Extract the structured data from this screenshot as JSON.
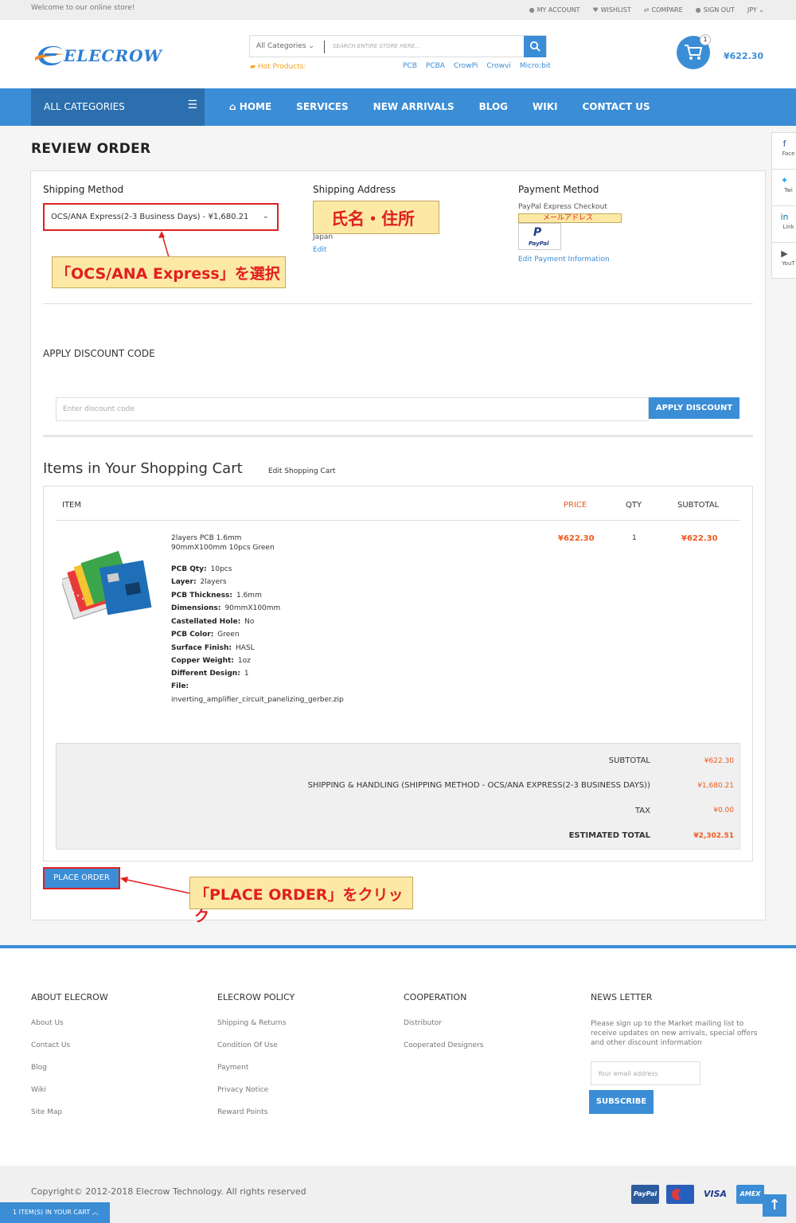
{
  "topbar": {
    "welcome": "Welcome to our online store!",
    "links": [
      "MY ACCOUNT",
      "WISHLIST",
      "COMPARE",
      "SIGN OUT",
      "JPY"
    ]
  },
  "header": {
    "logo": "ELECROW",
    "search_category": "All Categories",
    "search_placeholder": "SEARCH ENTIRE STORE HERE...",
    "hot_label": "Hot Products:",
    "hot_links": [
      "PCB",
      "PCBA",
      "CrowPi",
      "Crowvi",
      "Micro:bit"
    ],
    "cart_count": "1",
    "cart_total": "¥622.30"
  },
  "nav": {
    "all_categories": "ALL CATEGORIES",
    "items": [
      "HOME",
      "SERVICES",
      "NEW ARRIVALS",
      "BLOG",
      "WIKI",
      "CONTACT US"
    ]
  },
  "review": {
    "title": "REVIEW ORDER",
    "shipping_method_title": "Shipping Method",
    "shipping_method_value": "OCS/ANA Express(2-3 Business Days) - ¥1,680.21",
    "note_select": "「OCS/ANA Express」を選択",
    "shipping_address_title": "Shipping Address",
    "note_address": "氏名・住所",
    "address_country": "Japan",
    "address_edit": "Edit",
    "payment_title": "Payment Method",
    "payment_name": "PayPal Express Checkout",
    "note_email": "メールアドレス",
    "paypal_logo": "PayPal",
    "payment_edit": "Edit Payment Information",
    "discount_title": "APPLY DISCOUNT CODE",
    "discount_placeholder": "Enter discount code",
    "discount_button": "APPLY DISCOUNT"
  },
  "cart": {
    "title": "Items in Your Shopping Cart",
    "edit_link": "Edit Shopping Cart",
    "headers": [
      "ITEM",
      "PRICE",
      "QTY",
      "SUBTOTAL"
    ],
    "item": {
      "name_line1": "2layers PCB 1.6mm",
      "name_line2": "90mmX100mm 10pcs Green",
      "price": "¥622.30",
      "qty": "1",
      "subtotal": "¥622.30",
      "options": [
        {
          "label": "PCB Qty:",
          "value": "10pcs"
        },
        {
          "label": "Layer:",
          "value": "2layers"
        },
        {
          "label": "PCB Thickness:",
          "value": "1.6mm"
        },
        {
          "label": "Dimensions:",
          "value": "90mmX100mm"
        },
        {
          "label": "Castellated Hole:",
          "value": "No"
        },
        {
          "label": "PCB Color:",
          "value": "Green"
        },
        {
          "label": "Surface Finish:",
          "value": "HASL"
        },
        {
          "label": "Copper Weight:",
          "value": "1oz"
        },
        {
          "label": "Different Design:",
          "value": "1"
        },
        {
          "label": "File:",
          "value": ""
        }
      ],
      "file_name": "inverting_amplifier_circuit_panelizing_gerber.zip"
    },
    "totals": [
      {
        "label": "SUBTOTAL",
        "value": "¥622.30"
      },
      {
        "label": "SHIPPING & HANDLING (SHIPPING METHOD - OCS/ANA EXPRESS(2-3 BUSINESS DAYS))",
        "value": "¥1,680.21"
      },
      {
        "label": "TAX",
        "value": "¥0.00"
      },
      {
        "label": "ESTIMATED TOTAL",
        "value": "¥2,302.51"
      }
    ],
    "place_order": "PLACE ORDER",
    "note_place": "「PLACE ORDER」をクリック"
  },
  "social": [
    "Face",
    "Twi",
    "Link",
    "YouT"
  ],
  "footer": {
    "columns": [
      {
        "title": "ABOUT ELECROW",
        "links": [
          "About Us",
          "Contact Us",
          "Blog",
          "Wiki",
          "Site Map"
        ]
      },
      {
        "title": "ELECROW POLICY",
        "links": [
          "Shipping & Returns",
          "Condition Of Use",
          "Payment",
          "Privacy Notice",
          "Reward Points"
        ]
      },
      {
        "title": "COOPERATION",
        "links": [
          "Distributor",
          "Cooperated Designers"
        ]
      }
    ],
    "newsletter_title": "NEWS LETTER",
    "newsletter_text": "Please sign up to the Market mailing list to receive updates on new arrivals, special offers and other discount information",
    "newsletter_placeholder": "Your email address",
    "subscribe": "SUBSCRIBE",
    "copyright": "Copyright© 2012-2018 Elecrow Technology. All rights reserved",
    "payment_cards": [
      "PayPal",
      "Maestro",
      "VISA",
      "AMEX"
    ],
    "cart_bar": "1 ITEM(S) IN YOUR CART"
  },
  "colors": {
    "accent": "#3b8dd6",
    "nav_dark": "#2b6fae",
    "price": "#ef5a1f",
    "annotation_red": "#e02020",
    "annotation_bg": "#fde9a6"
  }
}
